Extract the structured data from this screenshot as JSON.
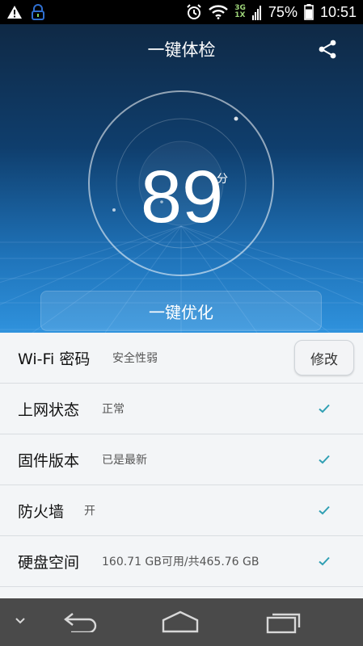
{
  "status_bar": {
    "battery": "75%",
    "time": "10:51",
    "network_top": "3G",
    "network_bottom": "1X",
    "icons": [
      "warning-icon",
      "lock-notification-icon",
      "alarm-icon",
      "wifi-icon",
      "signal-icon",
      "battery-icon"
    ]
  },
  "header": {
    "title": "一键体检",
    "share_icon": "share-icon"
  },
  "score": {
    "value": "89",
    "unit": "分"
  },
  "optimize_button": "一键优化",
  "items": [
    {
      "label": "Wi-Fi 密码",
      "status": "安全性弱",
      "action": "修改"
    },
    {
      "label": "上网状态",
      "status": "正常",
      "check": true
    },
    {
      "label": "固件版本",
      "status": "已是最新",
      "check": true
    },
    {
      "label": "防火墙",
      "status": "开",
      "check": true
    },
    {
      "label": "硬盘空间",
      "status": "160.71 GB可用/共465.76 GB",
      "check": true
    }
  ],
  "colors": {
    "accent_check": "#2f9fb3",
    "hero_top": "#0f2945",
    "hero_bottom": "#2f92dd"
  },
  "nav_icons": [
    "collapse-icon",
    "back-icon",
    "home-icon",
    "recent-apps-icon"
  ]
}
